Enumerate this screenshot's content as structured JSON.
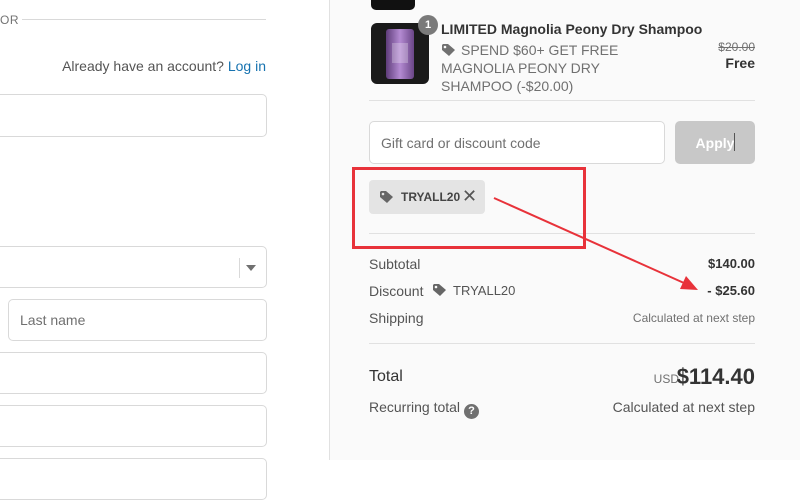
{
  "left": {
    "divider_text": "OR",
    "have_account_text": "Already have an account?",
    "login_link": "Log in",
    "last_name_placeholder": "Last name"
  },
  "summary": {
    "product": {
      "quantity": "1",
      "name": "LIMITED Magnolia Peony Dry Shampoo",
      "discount_text": "SPEND $60+ GET FREE MAGNOLIA PEONY DRY SHAMPOO (-$20.00)",
      "original_price": "$20.00",
      "price": "Free"
    },
    "discount_field": {
      "placeholder": "Gift card or discount code",
      "apply_label": "Apply"
    },
    "applied_code": "TRYALL20",
    "rows": {
      "subtotal_label": "Subtotal",
      "subtotal_value": "$140.00",
      "discount_label": "Discount",
      "discount_code": "TRYALL20",
      "discount_value": "- $25.60",
      "shipping_label": "Shipping",
      "shipping_value": "Calculated at next step"
    },
    "total": {
      "label": "Total",
      "currency": "USD",
      "value": "$114.40"
    },
    "recurring": {
      "label": "Recurring total",
      "value": "Calculated at next step"
    }
  },
  "colors": {
    "link": "#1773b0",
    "annotation": "#e8323a",
    "apply_disabled": "#c8c8c8"
  }
}
